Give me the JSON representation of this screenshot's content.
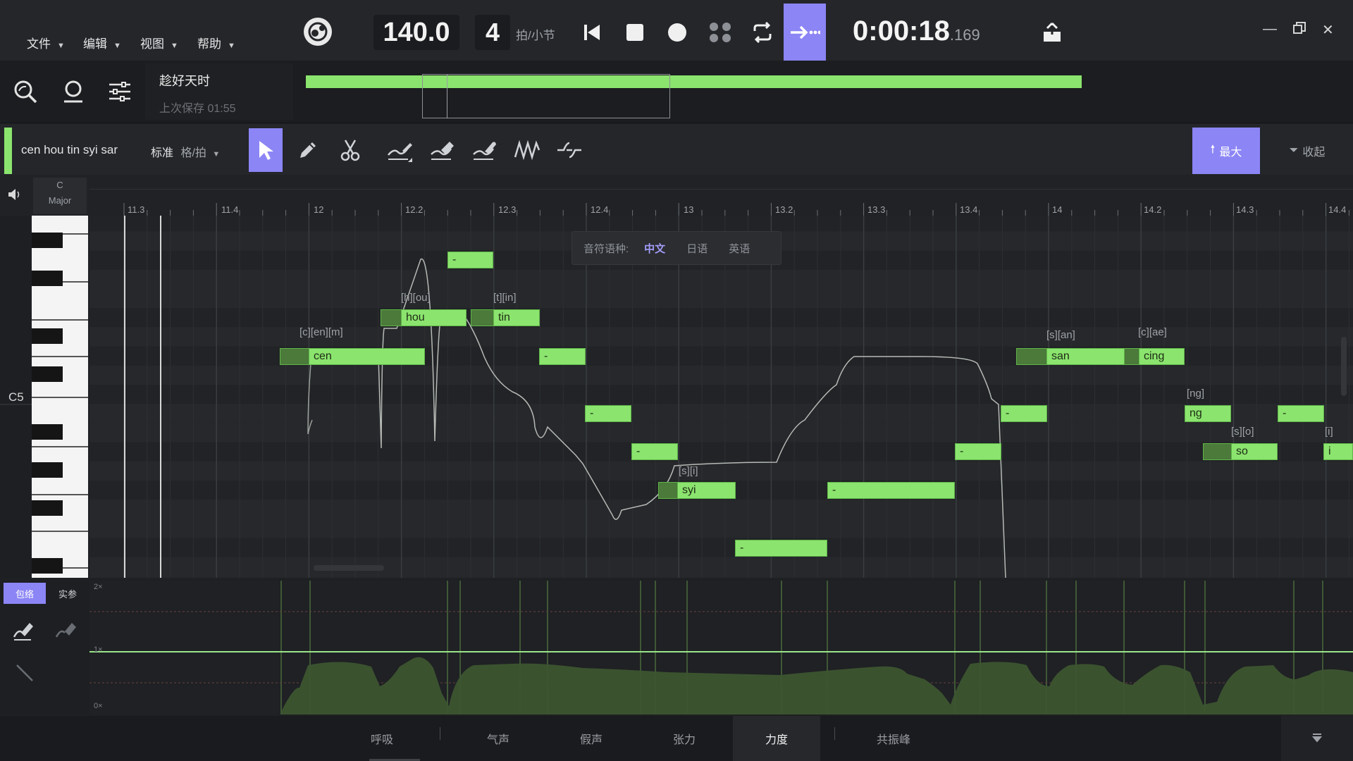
{
  "menu": [
    "文件",
    "编辑",
    "视图",
    "帮助"
  ],
  "transport": {
    "tempo": "140.0",
    "beats": "4",
    "beats_unit": "拍/小节",
    "time_main": "0:00:18",
    "time_ms": ".169"
  },
  "project": {
    "title": "趁好天时",
    "saved": "上次保存 01:55",
    "overview_progress": 1.0
  },
  "track": {
    "lyrics": "cen hou tin syi sar",
    "mode": "标准",
    "snap": "格/拍",
    "maximize": "最大",
    "collapse": "收起"
  },
  "key": {
    "root": "C",
    "mode": "Major",
    "label": "C5"
  },
  "ruler": [
    "11.3",
    "11.4",
    "12",
    "12.2",
    "12.3",
    "12.4",
    "13",
    "13.2",
    "13.3",
    "13.4",
    "14",
    "14.2",
    "14.3",
    "14.4"
  ],
  "lang_popup": {
    "label": "音符语种:",
    "options": [
      "中文",
      "日语",
      "英语"
    ],
    "selected": "中文"
  },
  "notes": [
    {
      "lyric": "cen",
      "phon": "[c][en][m]"
    },
    {
      "lyric": "hou",
      "phon": "[h][ou]"
    },
    {
      "lyric": "-",
      "phon": ""
    },
    {
      "lyric": "tin",
      "phon": "[t][in]"
    },
    {
      "lyric": "-",
      "phon": ""
    },
    {
      "lyric": "-",
      "phon": ""
    },
    {
      "lyric": "-",
      "phon": ""
    },
    {
      "lyric": "syi",
      "phon": "[s][i]"
    },
    {
      "lyric": "-",
      "phon": ""
    },
    {
      "lyric": "-",
      "phon": ""
    },
    {
      "lyric": "-",
      "phon": ""
    },
    {
      "lyric": "-",
      "phon": ""
    },
    {
      "lyric": "san",
      "phon": "[s][an]"
    },
    {
      "lyric": "cing",
      "phon": "[c][ae]"
    },
    {
      "lyric": "ng",
      "phon": "[ng]"
    },
    {
      "lyric": "so",
      "phon": "[s][o]"
    },
    {
      "lyric": "-",
      "phon": ""
    },
    {
      "lyric": "i",
      "phon": "[i]"
    }
  ],
  "lane": {
    "tabs": [
      "包络",
      "实参"
    ],
    "active_tab": "包络",
    "scale_top": "2×",
    "scale_mid": "1×",
    "scale_bottom": "0×"
  },
  "bottom_tabs": [
    "呼吸",
    "气声",
    "假声",
    "张力",
    "力度",
    "共振峰"
  ],
  "active_bottom_tab": "力度",
  "colors": {
    "accent": "#8c85f5",
    "note": "#8be46e",
    "note_dark": "#4b7a3a",
    "curve": "#9be68a"
  },
  "icons": [
    "logo-icon",
    "skip-start-icon",
    "stop-icon",
    "record-icon",
    "grid-icon",
    "loop-icon",
    "follow-icon",
    "export-icon",
    "minimize-icon",
    "restore-icon",
    "close-icon",
    "search-icon",
    "user-icon",
    "settings-icon",
    "select-tool-icon",
    "pencil-tool-icon",
    "scissors-tool-icon",
    "pitch-draw-icon",
    "pitch-erase-icon",
    "pitch-smooth-icon",
    "vibrato-icon",
    "transition-icon",
    "speaker-icon",
    "envelope-draw-icon",
    "envelope-erase-icon",
    "line-tool-icon",
    "collapse-lane-icon"
  ]
}
